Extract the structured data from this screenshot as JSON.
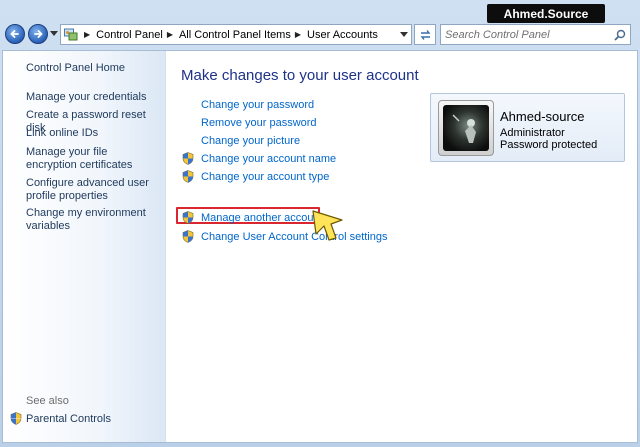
{
  "watermark": "Ahmed.Source",
  "address": {
    "breadcrumbs": [
      "Control Panel",
      "All Control Panel Items",
      "User Accounts"
    ]
  },
  "search": {
    "placeholder": "Search Control Panel"
  },
  "sidebar": {
    "items": [
      "Control Panel Home",
      "Manage your credentials",
      "Create a password reset disk",
      "Link online IDs",
      "Manage your file encryption certificates",
      "Configure advanced user profile properties",
      "Change my environment variables"
    ],
    "see_also": "See also",
    "parental_controls": "Parental Controls"
  },
  "main": {
    "title": "Make changes to your user account",
    "tasks": [
      "Change your password",
      "Remove your password",
      "Change your picture",
      "Change your account name",
      "Change your account type"
    ],
    "other_tasks": [
      "Manage another account",
      "Change User Account Control settings"
    ]
  },
  "account": {
    "name": "Ahmed-source",
    "role": "Administrator",
    "status": "Password protected"
  },
  "help_label": "?",
  "colors": {
    "link": "#0066cc",
    "title": "#1e3287",
    "highlight": "#d9262f"
  }
}
